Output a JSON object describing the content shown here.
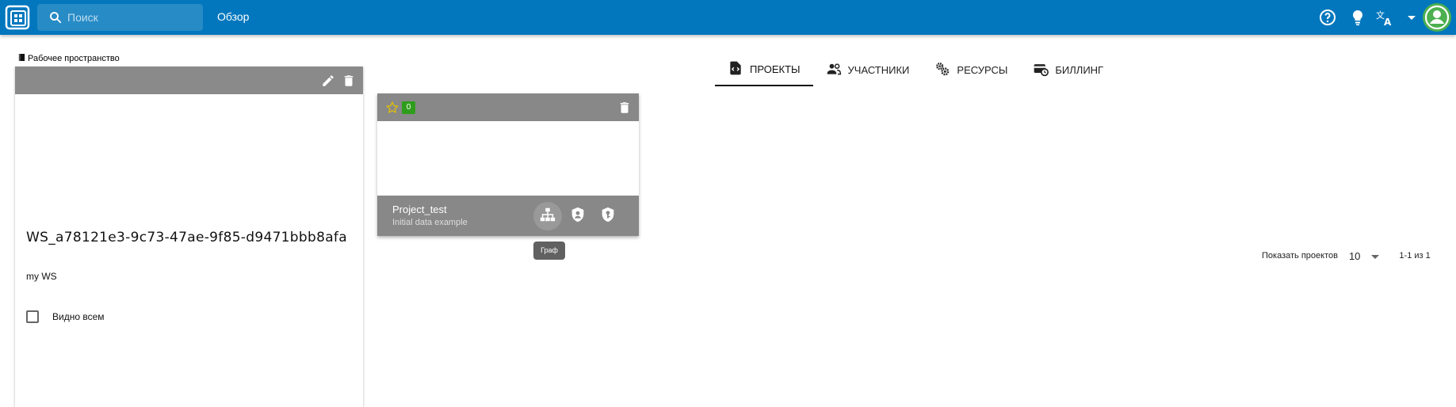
{
  "topbar": {
    "search_placeholder": "Поиск",
    "overview_label": "Обзор",
    "icons": [
      "help-circle-icon",
      "lightbulb-icon",
      "translate-icon",
      "caret-down-icon",
      "account-circle-icon"
    ]
  },
  "workspace": {
    "section_label": "Рабочее пространство",
    "name": "WS_a78121e3-9c73-47ae-9f85-d9471bbb8afa",
    "description": "my WS",
    "visible_label": "Видно всем",
    "visible_checked": false
  },
  "tabs": [
    {
      "label": "ПРОЕКТЫ",
      "icon": "file-code-icon",
      "active": true
    },
    {
      "label": "УЧАСТНИКИ",
      "icon": "people-icon",
      "active": false
    },
    {
      "label": "РЕСУРСЫ",
      "icon": "gears-icon",
      "active": false
    },
    {
      "label": "БИЛЛИНГ",
      "icon": "billing-icon",
      "active": false
    }
  ],
  "project": {
    "star_count": "0",
    "name": "Project_test",
    "description": "Initial data example",
    "tooltip": "Граф",
    "actions": [
      "graph-icon",
      "shield-account-icon",
      "shield-key-icon"
    ]
  },
  "pagination": {
    "label": "Показать проектов",
    "per_page": "10",
    "range": "1-1 из 1"
  },
  "colors": {
    "topbar": "#0277bd",
    "card_header": "#8a8a8a",
    "badge": "#2e9d1b",
    "avatar": "#4caf50"
  }
}
